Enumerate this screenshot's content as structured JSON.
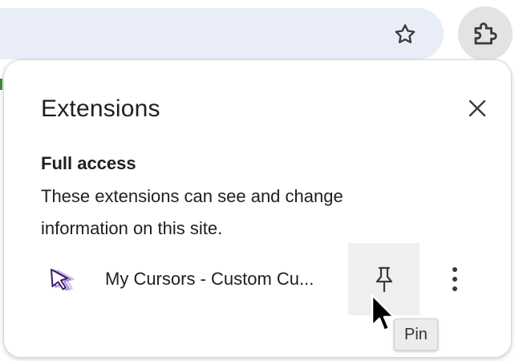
{
  "toolbar": {
    "bookmark_icon": "star-outline-icon",
    "extensions_icon": "puzzle-piece-icon"
  },
  "popup": {
    "title": "Extensions",
    "close_icon": "close-icon",
    "section": {
      "title": "Full access",
      "description": "These extensions can see and change information on this site."
    },
    "extensions": [
      {
        "name": "My Cursors - Custom Cu...",
        "icon": "cursor-arrows-icon",
        "pin_icon": "pin-icon",
        "more_icon": "more-vertical-icon"
      }
    ]
  },
  "tooltip": {
    "text": "Pin"
  },
  "colors": {
    "omnibox_bg": "#e8edf8",
    "hover_bg": "#efefef",
    "ext_icon_purple": "#3d1d6b"
  }
}
